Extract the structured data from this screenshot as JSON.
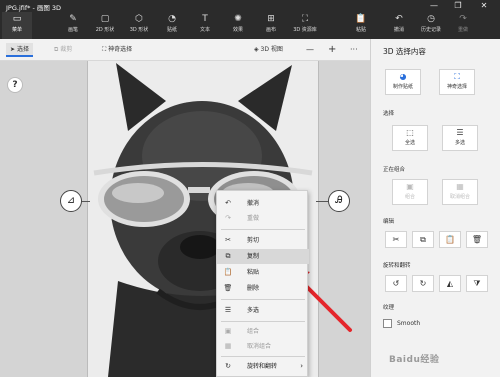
{
  "window": {
    "title": "JPG.jfif* - 画图 3D",
    "controls": [
      "—",
      "❐",
      "✕"
    ]
  },
  "ribbon": {
    "left": [
      {
        "label": "菜单",
        "icon": "▭"
      },
      {
        "label": "画笔",
        "icon": "✎"
      },
      {
        "label": "2D 形状",
        "icon": "▢"
      },
      {
        "label": "3D 形状",
        "icon": "⬡"
      },
      {
        "label": "贴纸",
        "icon": "◔"
      },
      {
        "label": "文本",
        "icon": "T"
      },
      {
        "label": "效果",
        "icon": "✺"
      },
      {
        "label": "画布",
        "icon": "⊞"
      },
      {
        "label": "3D 资源库",
        "icon": "⛶"
      }
    ],
    "right": [
      {
        "label": "粘贴",
        "icon": "📋"
      },
      {
        "label": "撤消",
        "icon": "↶"
      },
      {
        "label": "历史记录",
        "icon": "◷"
      },
      {
        "label": "重做",
        "icon": "↷"
      }
    ]
  },
  "toolbar": {
    "select": "选择",
    "crop": "裁剪",
    "magic_select": "神奇选择",
    "view3d": "3D 视图",
    "zoom_out": "—",
    "zoom_in": "+",
    "more": "···"
  },
  "canvas": {
    "help": "?",
    "left_handle": "⊿",
    "right_handle": "Ꭿ"
  },
  "context_menu": [
    {
      "label": "撤消",
      "icon": "↶",
      "state": "normal"
    },
    {
      "label": "重做",
      "icon": "↷",
      "state": "dim"
    },
    {
      "label": "剪切",
      "icon": "✂",
      "state": "normal"
    },
    {
      "label": "复制",
      "icon": "⧉",
      "state": "highlight"
    },
    {
      "label": "粘贴",
      "icon": "📋",
      "state": "normal"
    },
    {
      "label": "删除",
      "icon": "🗑",
      "state": "normal"
    },
    {
      "label": "多选",
      "icon": "☰",
      "state": "normal"
    },
    {
      "label": "组合",
      "icon": "▣",
      "state": "dim"
    },
    {
      "label": "取消组合",
      "icon": "▦",
      "state": "dim"
    },
    {
      "label": "旋转和翻转",
      "icon": "↻",
      "state": "normal",
      "submenu": "›"
    }
  ],
  "panel": {
    "title": "3D 选择内容",
    "top_buttons": [
      {
        "label": "制作贴纸",
        "icon": "◕"
      },
      {
        "label": "神奇选择",
        "icon": "⛶"
      }
    ],
    "select_section": "选择",
    "select_buttons": [
      {
        "label": "全选",
        "icon": "⬚"
      },
      {
        "label": "多选",
        "icon": "☰"
      }
    ],
    "group_section": "正在组合",
    "group_buttons": [
      {
        "label": "组合",
        "icon": "▣"
      },
      {
        "label": "取消组合",
        "icon": "▦"
      }
    ],
    "edit_section": "编辑",
    "edit_buttons": [
      "✂",
      "⧉",
      "📋",
      "🗑"
    ],
    "rotate_section": "旋转和翻转",
    "rotate_buttons": [
      "↺",
      "↻",
      "◭",
      "⧩"
    ],
    "texture_section": "纹理",
    "smooth_label": "Smooth"
  },
  "watermark": "Baidu经验"
}
